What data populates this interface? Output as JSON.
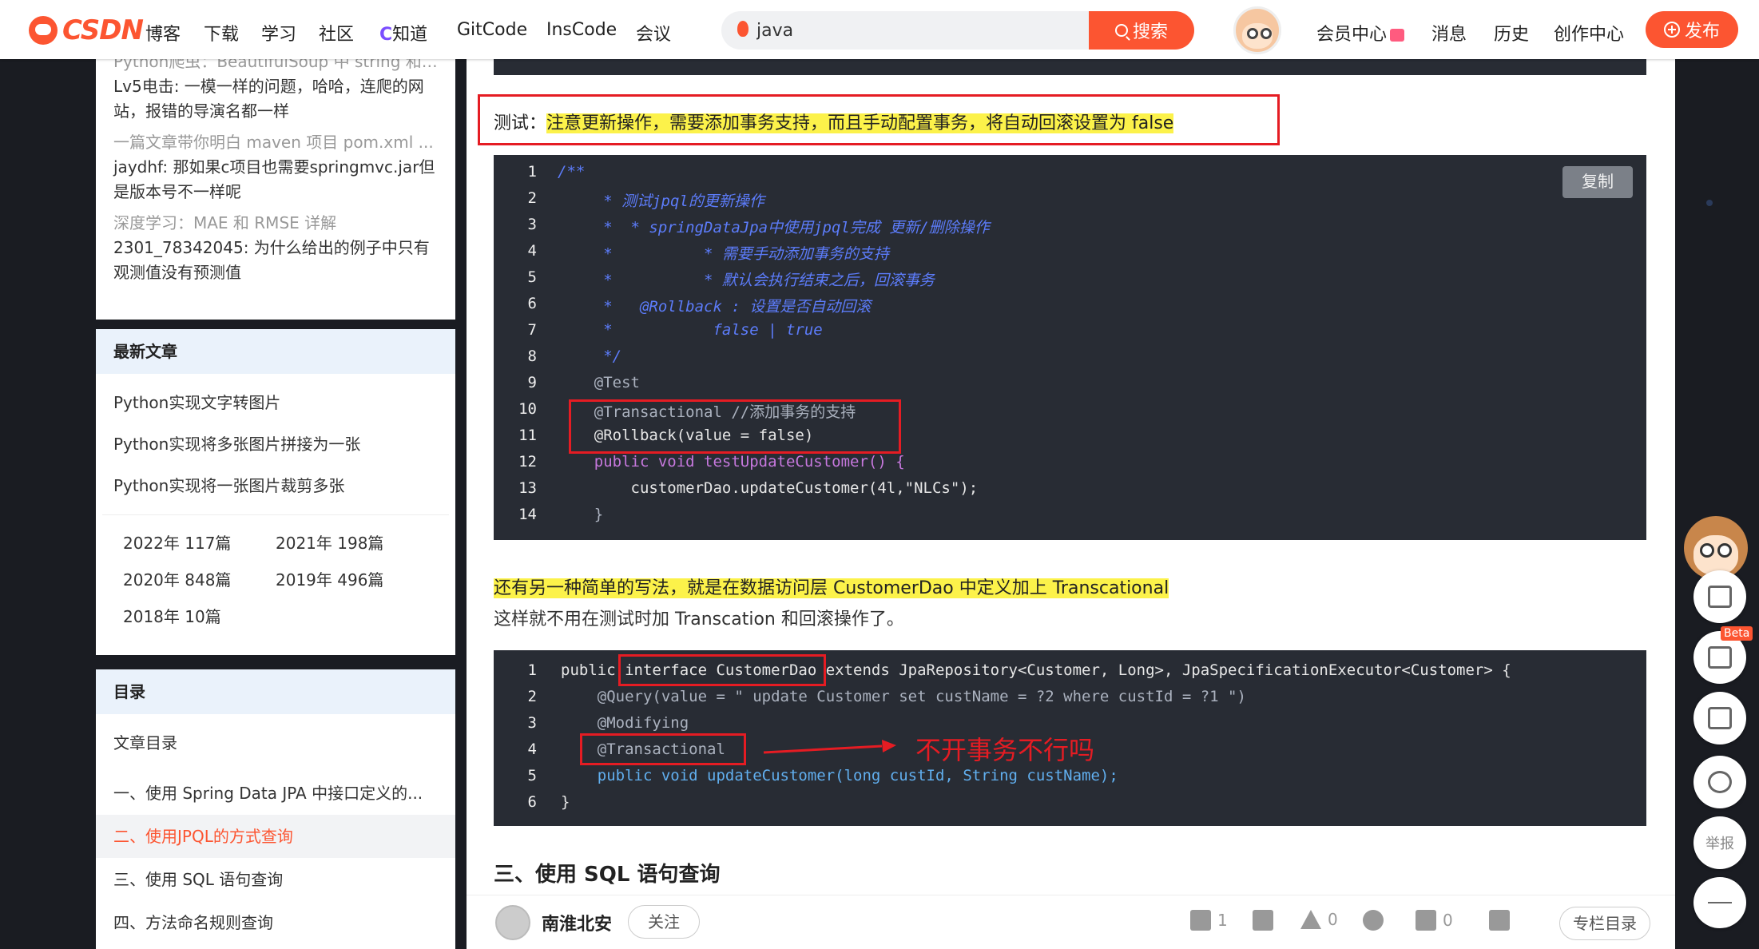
{
  "nav": {
    "logo": "CSDN",
    "links": [
      "博客",
      "下载",
      "学习",
      "社区",
      "知道",
      "GitCode",
      "InsCode",
      "会议"
    ],
    "zhidao_prefix": "C",
    "search_value": "java",
    "search_button": "搜索",
    "right_links": [
      "会员中心",
      "消息",
      "历史",
      "创作中心"
    ],
    "publish": "发布"
  },
  "sidebar": {
    "comments": [
      {
        "title": "Python爬虫：BeautifulSoup 中 string 和 ...",
        "body": "Lv5电击: 一模一样的问题，哈哈，连爬的网站，报错的导演名都一样"
      },
      {
        "title": "一篇文章带你明白 maven 项目 pom.xml ...",
        "body": "jaydhf: 那如果c项目也需要springmvc.jar但是版本号不一样呢"
      },
      {
        "title": "深度学习：MAE 和 RMSE 详解",
        "body": "2301_78342045: 为什么给出的例子中只有观测值没有预测值"
      }
    ],
    "latest_title": "最新文章",
    "latest": [
      "Python实现文字转图片",
      "Python实现将多张图片拼接为一张",
      "Python实现将一张图片裁剪多张"
    ],
    "archive": [
      "2022年  117篇",
      "2021年  198篇",
      "2020年  848篇",
      "2019年  496篇",
      "2018年  10篇"
    ],
    "toc_title": "目录",
    "toc_head": "文章目录",
    "toc": [
      "一、使用 Spring Data JPA 中接口定义的...",
      "二、使用JPQL的方式查询",
      "三、使用 SQL 语句查询",
      "四、方法命名规则查询"
    ]
  },
  "article": {
    "test_label": "测试：",
    "test_note": "注意更新操作，需要添加事务支持，而且手动配置事务，将自动回滚设置为 false",
    "copy": "复制",
    "code1_lines": [
      "/**",
      "     * 测试jpql的更新操作",
      "     *  * springDataJpa中使用jpql完成 更新/删除操作",
      "     *          * 需要手动添加事务的支持",
      "     *          * 默认会执行结束之后，回滚事务",
      "     *   @Rollback : 设置是否自动回滚",
      "     *           false | true",
      "     */",
      "    @Test",
      "    @Transactional //添加事务的支持",
      "    @Rollback(value = false)",
      "    public void testUpdateCustomer() {",
      "        customerDao.updateCustomer(4l,\"NLCs\");",
      "    }"
    ],
    "para1": "还有另一种简单的写法，就是在数据访问层 CustomerDao 中定义加上 Transcational",
    "para2": "这样就不用在测试时加 Transcation 和回滚操作了。",
    "code2_lines": [
      "public interface CustomerDao extends JpaRepository<Customer, Long>, JpaSpecificationExecutor<Customer> {",
      "    @Query(value = \" update Customer set custName = ?2 where custId = ?1 \")",
      "    @Modifying",
      "    @Transactional",
      "    public void updateCustomer(long custId, String custName);",
      "}"
    ],
    "annotation": "不开事务不行吗",
    "section3": "三、使用 SQL 语句查询"
  },
  "bottom": {
    "author": "南淮北安",
    "follow": "关注",
    "likes": "1",
    "stars": "0",
    "comments": "0",
    "column": "专栏目录"
  },
  "fab": {
    "report": "举报",
    "beta": "Beta"
  }
}
